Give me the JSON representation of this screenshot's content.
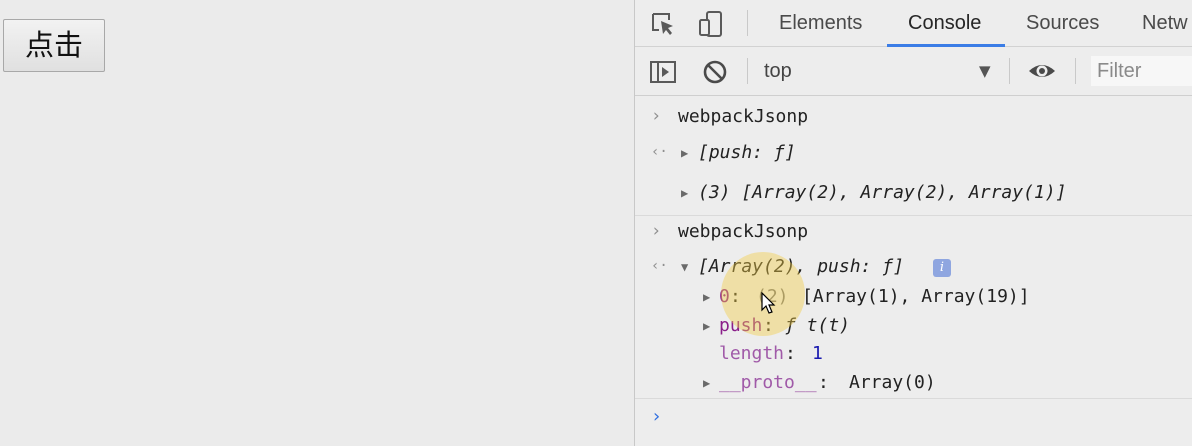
{
  "page": {
    "button_label": "点击"
  },
  "devtools": {
    "tabs": [
      "Elements",
      "Console",
      "Sources",
      "Netw"
    ],
    "active_tab": "Console",
    "toolbar": {
      "context": "top",
      "filter_placeholder": "Filter"
    },
    "icons": [
      "inspect-icon",
      "device-toggle-icon",
      "sidebar-toggle-icon",
      "clear-console-icon",
      "dropdown-caret-icon",
      "eye-icon"
    ],
    "colors": {
      "accent": "#3b7de6",
      "property_key": "#8a1f8a",
      "number": "#1a1ab0",
      "prompt": "#2f6fe0"
    },
    "console": {
      "input1": "webpackJsonp",
      "result1": "[push: ƒ]",
      "log1": "(3) [Array(2), Array(2), Array(1)]",
      "input2": "webpackJsonp",
      "result2": "[Array(2), push: ƒ]",
      "info_badge": "i",
      "entries": {
        "e0_key": "0",
        "e0_colon": ":",
        "e0_count": "(2)",
        "e0_value": "[Array(1), Array(19)]",
        "push_key": "push",
        "push_colon": ":",
        "push_value": "ƒ t(t)",
        "length_key": "length",
        "length_colon": ":",
        "length_value": "1",
        "proto_key": "__proto__",
        "proto_colon": ":",
        "proto_value": "Array(0)"
      }
    }
  }
}
